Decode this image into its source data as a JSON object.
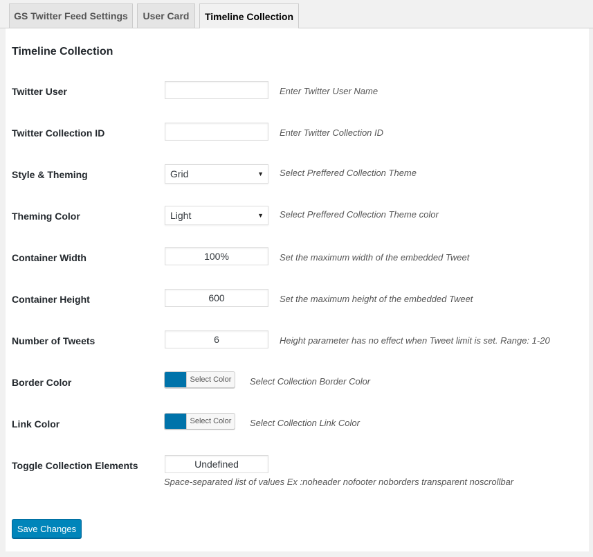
{
  "tabs": [
    {
      "label": "GS Twitter Feed Settings"
    },
    {
      "label": "User Card"
    },
    {
      "label": "Timeline Collection"
    }
  ],
  "section_title": "Timeline Collection",
  "fields": {
    "twitter_user": {
      "label": "Twitter User",
      "value": "",
      "description": "Enter Twitter User Name"
    },
    "collection_id": {
      "label": "Twitter Collection ID",
      "value": "",
      "description": "Enter Twitter Collection ID"
    },
    "style_theming": {
      "label": "Style & Theming",
      "value": "Grid",
      "description": "Select Preffered Collection Theme"
    },
    "theming_color": {
      "label": "Theming Color",
      "value": "Light",
      "description": "Select Preffered Collection Theme color"
    },
    "container_width": {
      "label": "Container Width",
      "value": "100%",
      "description": "Set the maximum width of the embedded Tweet"
    },
    "container_height": {
      "label": "Container Height",
      "value": "600",
      "description": "Set the maximum height of the embedded Tweet"
    },
    "number_of_tweets": {
      "label": "Number of Tweets",
      "value": "6",
      "description": "Height parameter has no effect when Tweet limit is set. Range: 1-20"
    },
    "border_color": {
      "label": "Border Color",
      "button_label": "Select Color",
      "color": "#0073aa",
      "description": "Select Collection Border Color"
    },
    "link_color": {
      "label": "Link Color",
      "button_label": "Select Color",
      "color": "#0073aa",
      "description": "Select Collection Link Color"
    },
    "toggle_elements": {
      "label": "Toggle Collection Elements",
      "value": "Undefined",
      "description": "Space-separated list of values Ex :noheader nofooter noborders transparent noscrollbar"
    }
  },
  "save_button": "Save Changes",
  "colors": {
    "accent": "#0085ba",
    "swatch": "#0073aa"
  }
}
